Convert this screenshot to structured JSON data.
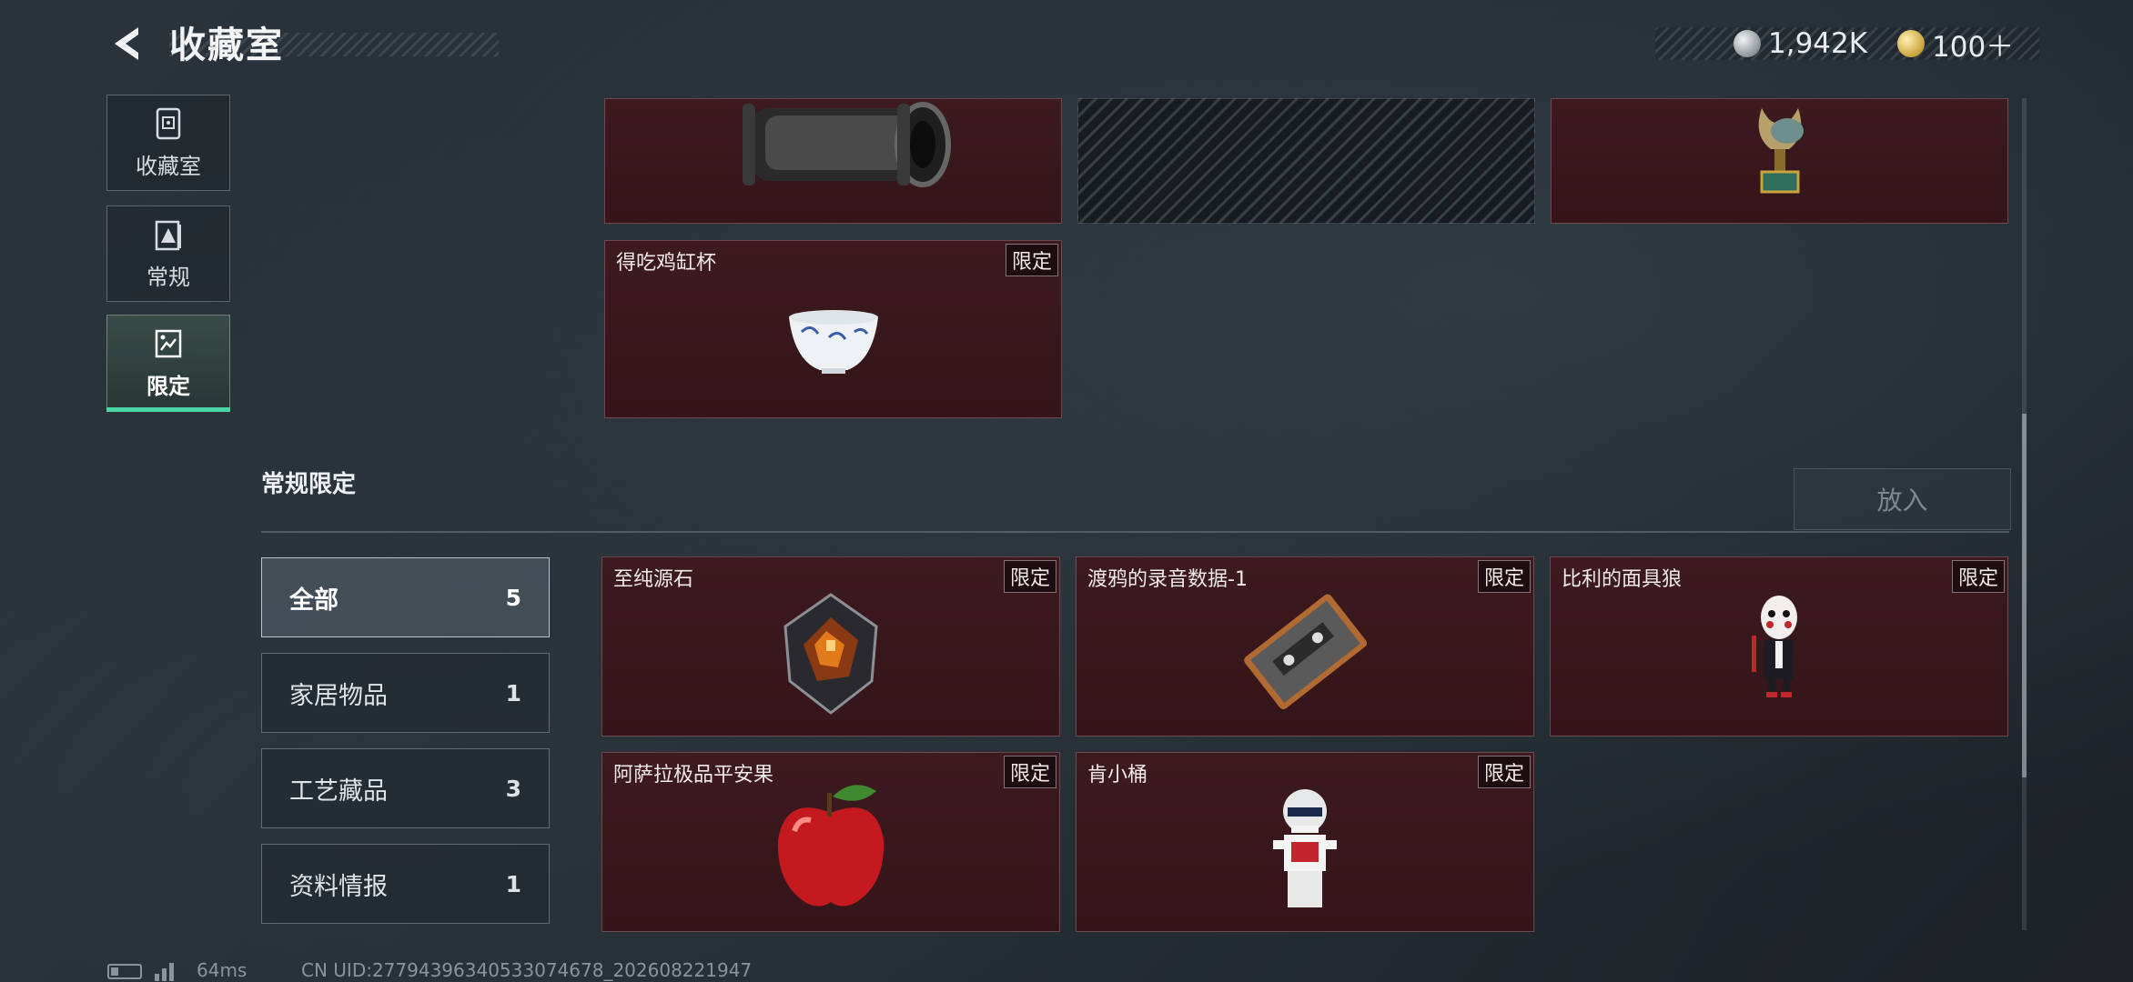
{
  "header": {
    "title": "收藏室",
    "currencies": [
      {
        "icon": "silver-coin-icon",
        "value": "1,942K"
      },
      {
        "icon": "gold-coin-icon",
        "value": "100＋"
      }
    ]
  },
  "sidebar": {
    "items": [
      {
        "label": "收藏室",
        "icon": "collection-room-icon",
        "active": false
      },
      {
        "label": "常规",
        "icon": "regular-icon",
        "active": false
      },
      {
        "label": "限定",
        "icon": "limited-icon",
        "active": true
      }
    ]
  },
  "top_cards": {
    "items": [
      {
        "name": "",
        "tag": ""
      },
      {
        "name": "",
        "tag": ""
      },
      {
        "name": "",
        "tag": ""
      },
      {
        "name": "得吃鸡缸杯",
        "tag": "限定"
      }
    ]
  },
  "section": {
    "title": "常规限定",
    "put_button": "放入"
  },
  "filters": [
    {
      "label": "全部",
      "count": "5",
      "active": true
    },
    {
      "label": "家居物品",
      "count": "1",
      "active": false
    },
    {
      "label": "工艺藏品",
      "count": "3",
      "active": false
    },
    {
      "label": "资料情报",
      "count": "1",
      "active": false
    }
  ],
  "items": [
    {
      "name": "至纯源石",
      "tag": "限定"
    },
    {
      "name": "渡鸦的录音数据-1",
      "tag": "限定"
    },
    {
      "name": "比利的面具狼",
      "tag": "限定"
    },
    {
      "name": "阿萨拉极品平安果",
      "tag": "限定"
    },
    {
      "name": "肯小桶",
      "tag": "限定"
    }
  ],
  "footer": {
    "ping": "64ms",
    "uid": "CN UID:277943963405330746‍78_202608221947"
  },
  "colors": {
    "card_bg": "#3c1a1f",
    "accent_green": "#49d7a5",
    "background": "#222a31"
  }
}
